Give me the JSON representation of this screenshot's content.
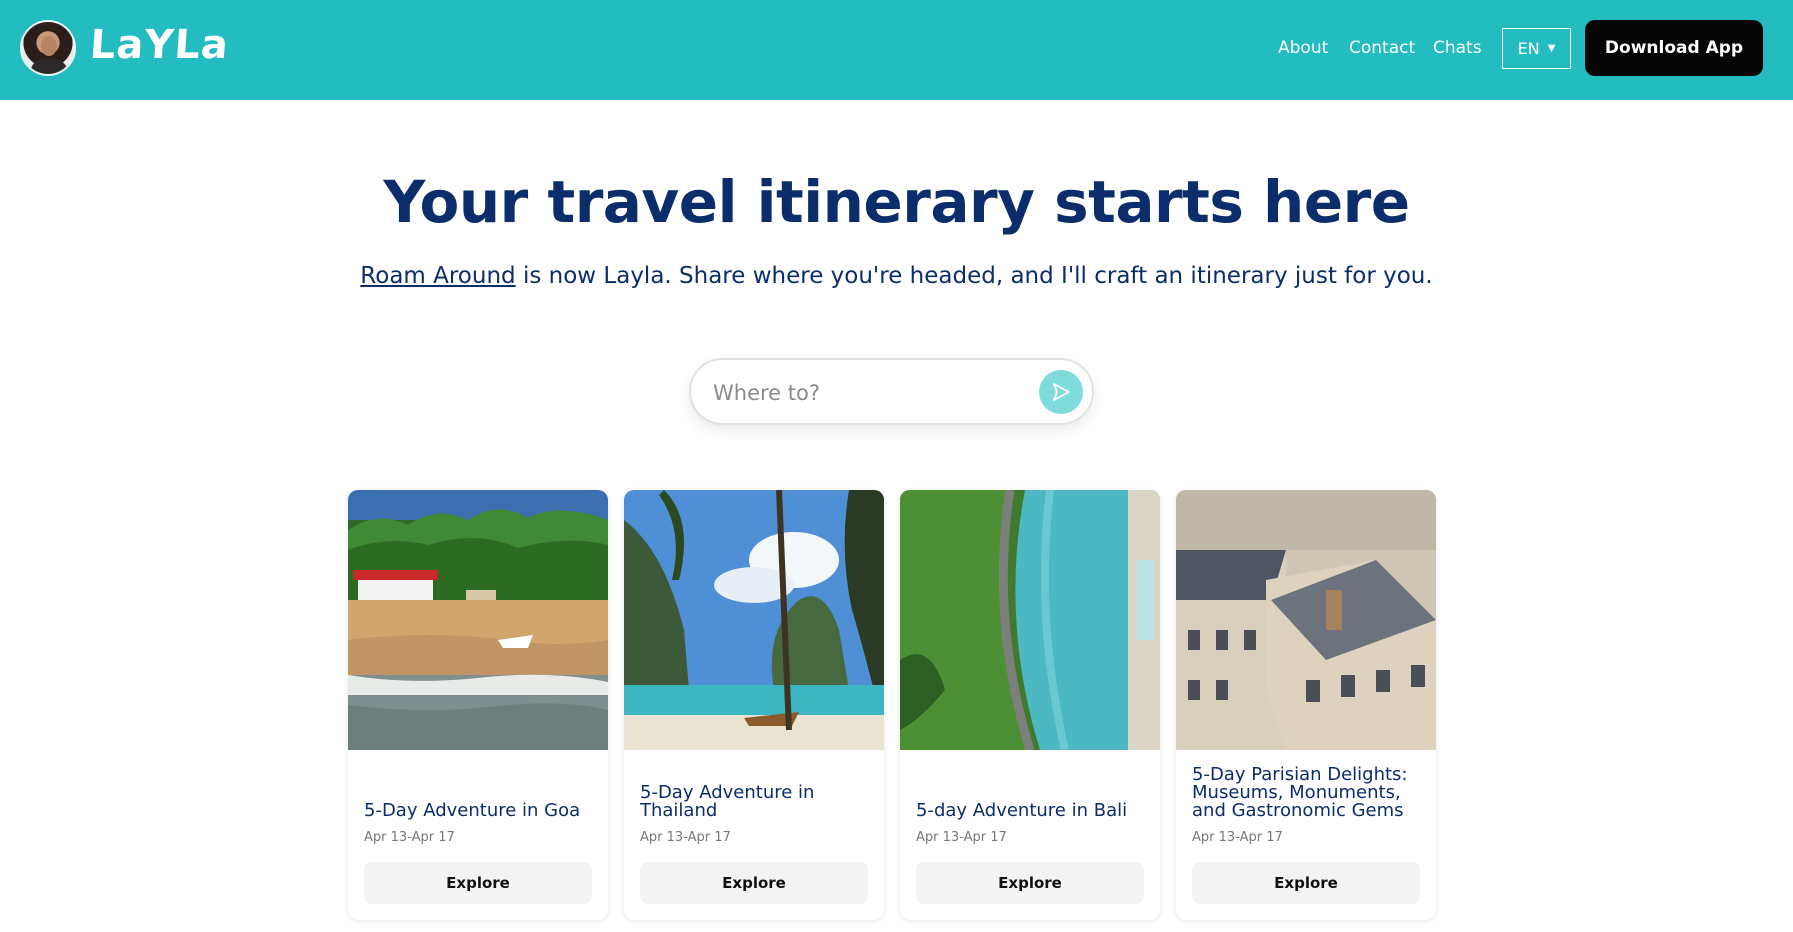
{
  "brand": {
    "name": "LaYLa"
  },
  "nav": {
    "about": "About",
    "contact": "Contact",
    "chats": "Chats",
    "language": "EN",
    "download": "Download App"
  },
  "hero": {
    "title": "Your travel itinerary starts here",
    "link": "Roam Around",
    "subtitle_rest": " is now Layla. Share where you're headed, and I'll craft an itinerary just for you."
  },
  "search": {
    "placeholder": "Where to?"
  },
  "colors": {
    "accent": "#22bcc1",
    "heading": "#0c2d6b",
    "send": "#7fdcdc"
  },
  "cards": [
    {
      "title": "5-Day Adventure in Goa",
      "dates": "Apr 13-Apr 17",
      "button": "Explore"
    },
    {
      "title": "5-Day Adventure in Thailand",
      "dates": "Apr 13-Apr 17",
      "button": "Explore"
    },
    {
      "title": "5-day Adventure in Bali",
      "dates": "Apr 13-Apr 17",
      "button": "Explore"
    },
    {
      "title": "5-Day Parisian Delights: Museums, Monuments, and Gastronomic Gems",
      "dates": "Apr 13-Apr 17",
      "button": "Explore"
    }
  ]
}
